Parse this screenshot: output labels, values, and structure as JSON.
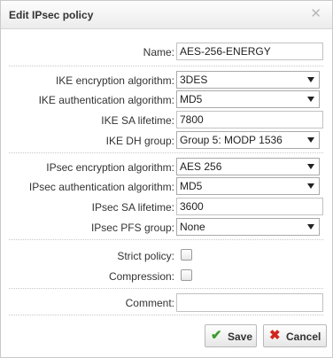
{
  "dialog": {
    "title": "Edit IPsec policy",
    "close_icon": "close-icon"
  },
  "fields": {
    "name": {
      "label": "Name:",
      "value": "AES-256-ENERGY"
    },
    "ike_encryption": {
      "label": "IKE encryption algorithm:",
      "value": "3DES"
    },
    "ike_auth": {
      "label": "IKE authentication algorithm:",
      "value": "MD5"
    },
    "ike_sa_lifetime": {
      "label": "IKE SA lifetime:",
      "value": "7800"
    },
    "ike_dh_group": {
      "label": "IKE DH group:",
      "value": "Group 5: MODP 1536"
    },
    "ipsec_encryption": {
      "label": "IPsec encryption algorithm:",
      "value": "AES 256"
    },
    "ipsec_auth": {
      "label": "IPsec authentication algorithm:",
      "value": "MD5"
    },
    "ipsec_sa_lifetime": {
      "label": "IPsec SA lifetime:",
      "value": "3600"
    },
    "ipsec_pfs_group": {
      "label": "IPsec PFS group:",
      "value": "None"
    },
    "strict_policy": {
      "label": "Strict policy:",
      "checked": false
    },
    "compression": {
      "label": "Compression:",
      "checked": false
    },
    "comment": {
      "label": "Comment:",
      "value": ""
    }
  },
  "buttons": {
    "save_label": "Save",
    "save_icon": "checkmark-icon",
    "cancel_label": "Cancel",
    "cancel_icon": "cross-icon"
  },
  "colors": {
    "save_icon": "#3a9c2e",
    "cancel_icon": "#d0261e"
  }
}
